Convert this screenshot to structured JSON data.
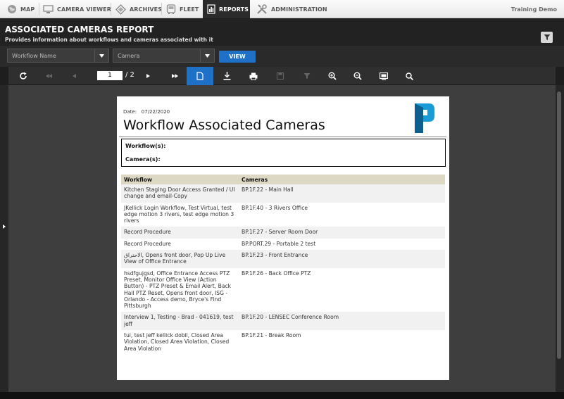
{
  "nav": {
    "items": [
      {
        "label": "MAP",
        "icon": "globe-icon"
      },
      {
        "label": "CAMERA VIEWER",
        "icon": "monitor-icon"
      },
      {
        "label": "ARCHIVES",
        "icon": "archive-icon"
      },
      {
        "label": "FLEET",
        "icon": "bus-icon"
      },
      {
        "label": "REPORTS",
        "icon": "report-icon",
        "active": true
      },
      {
        "label": "ADMINISTRATION",
        "icon": "tools-icon"
      }
    ],
    "user": "Training Demo"
  },
  "report": {
    "title": "ASSOCIATED CAMERAS REPORT",
    "subtitle": "Provides information about workflows and cameras associated with it"
  },
  "filters": {
    "workflow_placeholder": "Workflow Name",
    "camera_placeholder": "Camera",
    "view_label": "VIEW"
  },
  "toolbar": {
    "current_page": "1",
    "total_pages": "/ 2"
  },
  "document": {
    "date_label": "Date:",
    "date_value": "07/22/2020",
    "title": "Workflow Associated Cameras",
    "workflows_label": "Workflow(s):",
    "cameras_label": "Camera(s):",
    "columns": [
      "Workflow",
      "Cameras"
    ],
    "rows": [
      {
        "workflow": "Kitchen Staging Door Access Granted / UI change and email-Copy",
        "camera": "BP.1F.22 - Main Hall"
      },
      {
        "workflow": "JKellick Login Workflow, Test Virtual, test edge motion 3 rivers, test edge motion 3 rivers",
        "camera": "BP.1F.40 - 3 Rivers Office"
      },
      {
        "workflow": "Record Procedure",
        "camera": "BP.1F.27 - Server Room Door"
      },
      {
        "workflow": "Record Procedure",
        "camera": "BP.PORT.29 - Portable 2 test"
      },
      {
        "workflow": "الاحتراق, Opens front door, Pop Up Live View of Office Entrance",
        "camera": "BP.1F.23 - Front Entrance"
      },
      {
        "workflow": "hsdfgujgsd, Office Entrance Access PTZ Preset, Monitor Office View (Action Button) - PTZ Preset & Email Alert, Back Hall PTZ Reset, Opens front door, ISG - Orlando - Access demo, Bryce's Find Pittsburgh",
        "camera": "BP.1F.26 - Back Office PTZ"
      },
      {
        "workflow": "Interview 1, Testing - Brad - 041619, test jeff",
        "camera": "BP.1F.20 - LENSEC Conference Room"
      },
      {
        "workflow": "tui, test jeff kellick dobil, Closed Area Violation, Closed Area Violation, Closed Area Violation",
        "camera": "BP.1F.21 - Break Room"
      }
    ]
  },
  "colors": {
    "accent": "#1f71c8",
    "header_bg": "#222222",
    "table_header": "#ddd8c4",
    "logo": "#1a9bd7"
  }
}
